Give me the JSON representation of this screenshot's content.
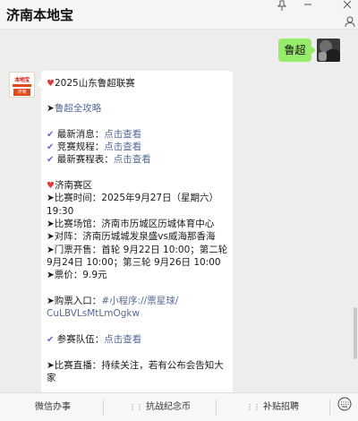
{
  "window": {
    "title": "济南本地宝",
    "icons": [
      "pin-icon",
      "minimize-icon",
      "close-icon",
      "user-profile-icon"
    ]
  },
  "chat": {
    "my_message": "鲁超",
    "bot_avatar_text": {
      "top": "本地宝",
      "bottom": "济南"
    },
    "bot_message": {
      "line1": {
        "heart": "♥",
        "text": "2025山东鲁超联赛"
      },
      "line2": {
        "arrow": "➤",
        "link": "鲁超全攻略"
      },
      "line3": {
        "check": "✔",
        "label": "最新消息：",
        "link": "点击查看"
      },
      "line4": {
        "check": "✔",
        "label": "竞赛规程：",
        "link": "点击查看"
      },
      "line5": {
        "check": "✔",
        "label": "最新赛程表：",
        "link": "点击查看"
      },
      "line6": {
        "heart": "♥",
        "text": "济南赛区"
      },
      "line7": "➤比赛时间：2025年9月27日（星期六）",
      "line8": "19:30",
      "line9": "➤比赛场馆：济南市历城区历城体育中心",
      "line10": "➤对阵：济南历城城发泉盛vs威海那香海",
      "line11": "➤门票开售：首轮 9月22日 10:00；第二轮",
      "line12": "9月24日 10:00；第三轮 9月26日 10:00",
      "line13": "➤票价：9.9元",
      "line14": {
        "label": "➤购票入口：",
        "link": "#小程序://票星球/"
      },
      "line15": {
        "link": "CuLBVLsMtLmOgkw"
      },
      "line16": {
        "check": "✔",
        "label": "参赛队伍：",
        "link": "点击查看"
      },
      "line17": "➤比赛直播：持续关注，若有公布会告知大",
      "line18": "家"
    }
  },
  "menu": {
    "item1": {
      "prefix": "",
      "label": "微信办事"
    },
    "item2": {
      "prefix": "⋮⋮",
      "label": "抗战纪念币"
    },
    "item3": {
      "prefix": "⋮⋮",
      "label": "补贴招聘"
    },
    "keyboard_icon": "keyboard-icon"
  },
  "colors": {
    "my_bubble": "#95ec69",
    "link": "#576b95",
    "heart": "#e33b3b",
    "check": "#7b5cd6"
  }
}
